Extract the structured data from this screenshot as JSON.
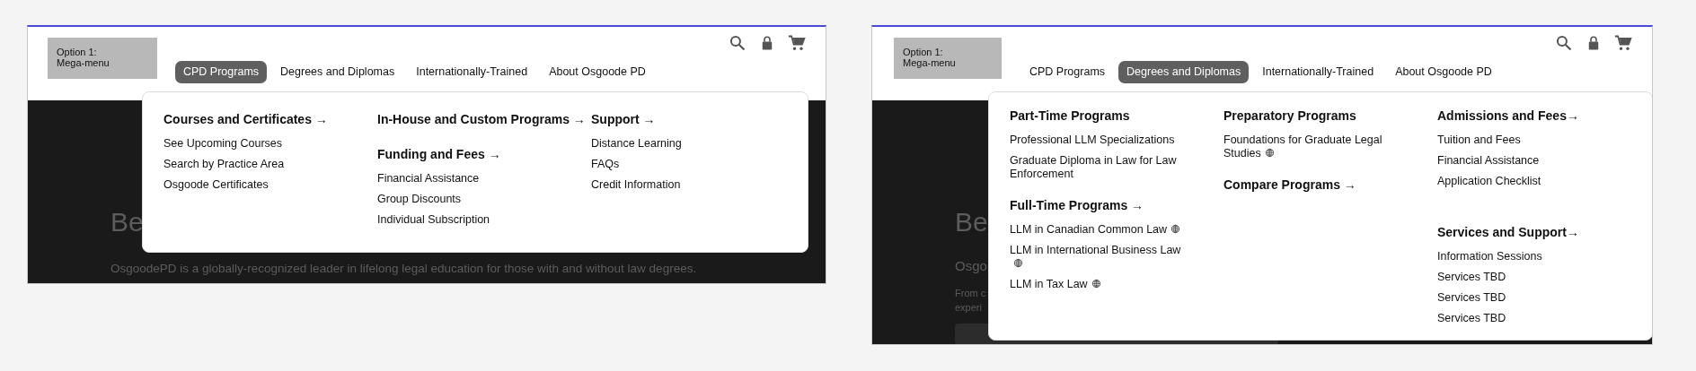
{
  "panels": [
    {
      "logo": [
        "Option 1:",
        "Mega-menu"
      ],
      "nav": [
        {
          "label": "CPD Programs",
          "selected": true
        },
        {
          "label": "Degrees and Diplomas",
          "selected": false
        },
        {
          "label": "Internationally-Trained",
          "selected": false
        },
        {
          "label": "About Osgoode PD",
          "selected": false
        }
      ],
      "hero": [
        {
          "kind": "title",
          "text": "Be"
        },
        {
          "kind": "body",
          "text": "OsgoodePD is a globally-recognized leader in lifelong legal education for those with and without law degrees."
        }
      ],
      "menu": {
        "columns": [
          {
            "groups": [
              {
                "heading": "Courses and Certificates →",
                "items": [
                  {
                    "label": "See Upcoming Courses",
                    "globe": false
                  },
                  {
                    "label": "Search by Practice Area",
                    "globe": false
                  },
                  {
                    "label": "Osgoode Certificates",
                    "globe": false
                  }
                ]
              }
            ]
          },
          {
            "groups": [
              {
                "heading": "In-House and Custom Programs →"
              },
              {
                "heading": "Funding and Fees →",
                "items": [
                  {
                    "label": "Financial Assistance",
                    "globe": false
                  },
                  {
                    "label": "Group Discounts",
                    "globe": false
                  },
                  {
                    "label": "Individual Subscription",
                    "globe": false
                  }
                ]
              }
            ]
          },
          {
            "groups": [
              {
                "heading": "Support →",
                "items": [
                  {
                    "label": "Distance Learning",
                    "globe": false
                  },
                  {
                    "label": "FAQs",
                    "globe": false
                  },
                  {
                    "label": "Credit Information",
                    "globe": false
                  }
                ]
              }
            ]
          }
        ]
      }
    },
    {
      "logo": [
        "Option 1:",
        "Mega-menu"
      ],
      "nav": [
        {
          "label": "CPD Programs",
          "selected": false
        },
        {
          "label": "Degrees and Diplomas",
          "selected": true
        },
        {
          "label": "Internationally-Trained",
          "selected": false
        },
        {
          "label": "About Osgoode PD",
          "selected": false
        }
      ],
      "hero": [
        {
          "kind": "title",
          "text": "Be"
        },
        {
          "kind": "body",
          "text": "Osgo"
        },
        {
          "kind": "small",
          "text": "From c"
        },
        {
          "kind": "small",
          "text": "experi"
        },
        {
          "kind": "field"
        }
      ],
      "menu": {
        "columns": [
          {
            "groups": [
              {
                "heading": "Part-Time Programs",
                "items": [
                  {
                    "label": "Professional LLM Specializations",
                    "globe": false
                  },
                  {
                    "label": "Graduate Diploma in Law for Law Enforcement",
                    "globe": false
                  }
                ]
              },
              {
                "heading": "Full-Time Programs →",
                "items": [
                  {
                    "label": "LLM in Canadian Common Law",
                    "globe": true
                  },
                  {
                    "label": "LLM in International Business Law",
                    "globe": true
                  },
                  {
                    "label": "LLM in Tax Law",
                    "globe": true
                  }
                ]
              }
            ]
          },
          {
            "groups": [
              {
                "heading": "Preparatory Programs",
                "items": [
                  {
                    "label": "Foundations for Graduate Legal Studies",
                    "globe": true
                  }
                ]
              },
              {
                "heading": "Compare Programs →"
              }
            ]
          },
          {
            "groups": [
              {
                "heading": "Admissions and Fees→",
                "items": [
                  {
                    "label": "Tuition and Fees",
                    "globe": false
                  },
                  {
                    "label": "Financial Assistance",
                    "globe": false
                  },
                  {
                    "label": "Application Checklist",
                    "globe": false
                  }
                ]
              },
              {
                "heading": "Services and Support→",
                "items": [
                  {
                    "label": "Information Sessions",
                    "globe": false
                  },
                  {
                    "label": "Services TBD",
                    "globe": false
                  },
                  {
                    "label": "Services TBD",
                    "globe": false
                  },
                  {
                    "label": "Services TBD",
                    "globe": false
                  }
                ]
              }
            ]
          }
        ]
      }
    }
  ]
}
